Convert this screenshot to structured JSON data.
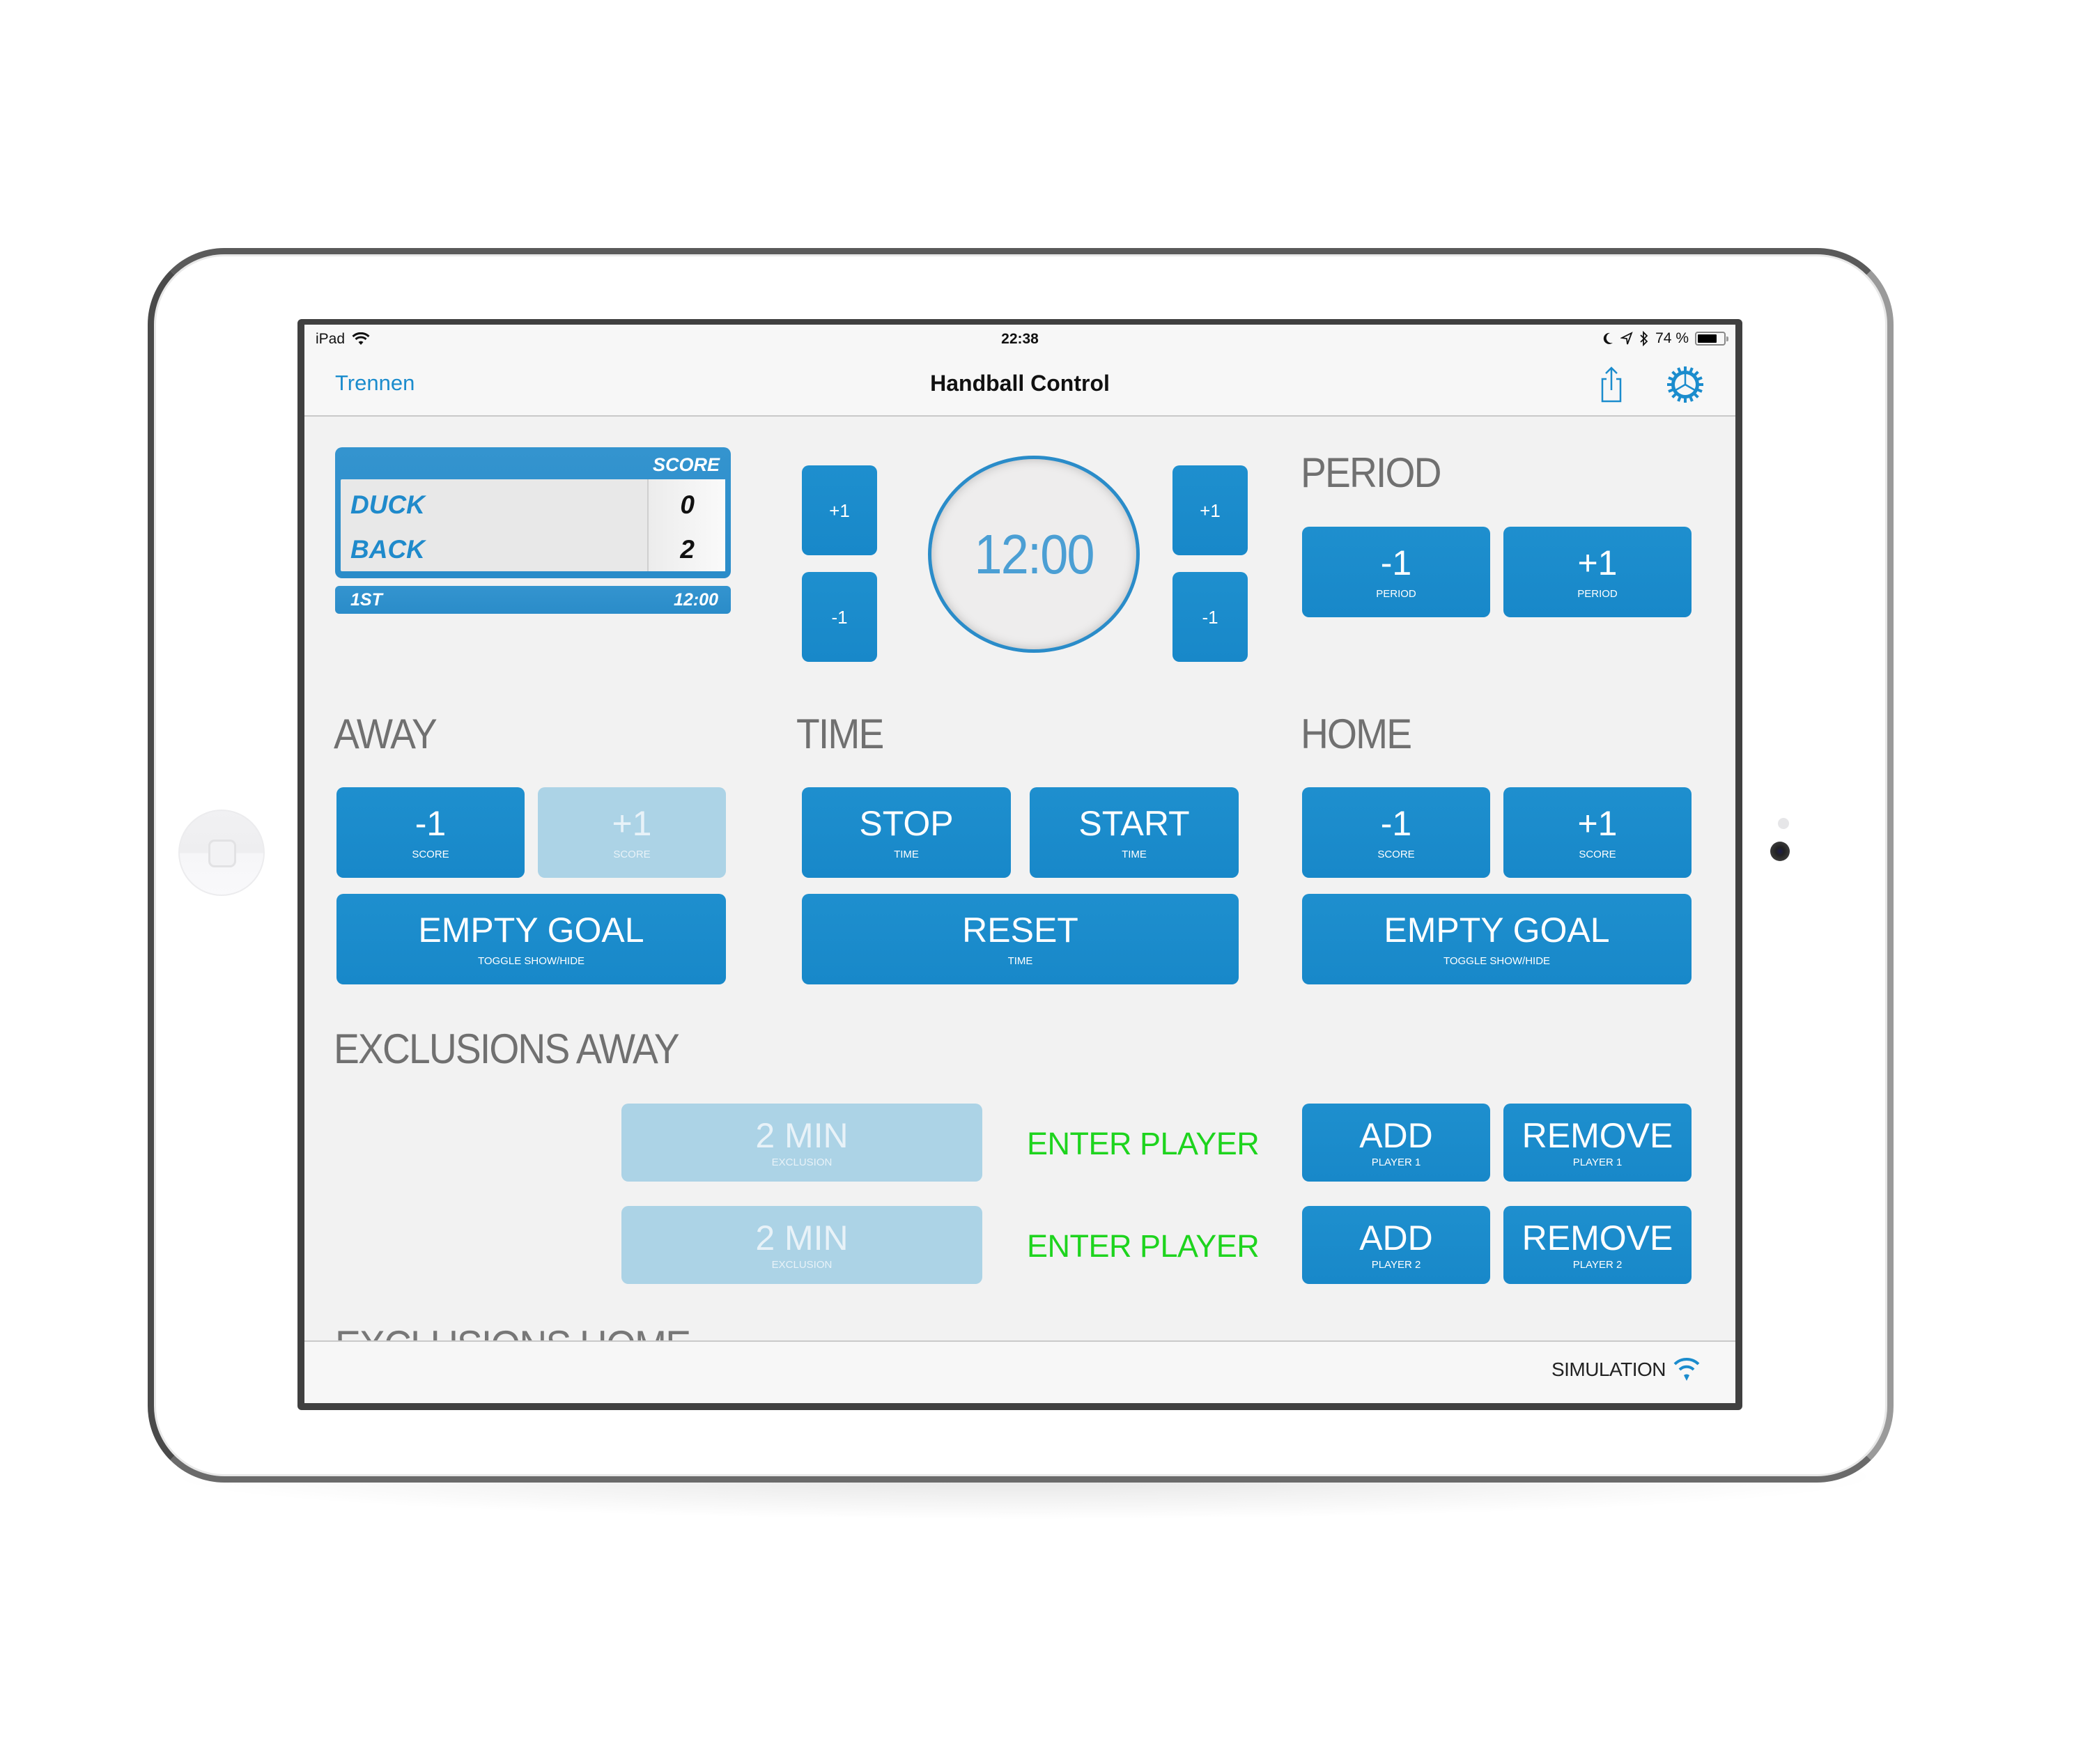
{
  "status_bar": {
    "device": "iPad",
    "time": "22:38",
    "battery_text": "74 %",
    "battery_level": 0.74,
    "icons": [
      "wifi-icon",
      "moon-icon",
      "location-arrow-icon",
      "bluetooth-icon",
      "battery-icon"
    ]
  },
  "nav": {
    "back_label": "Trennen",
    "title": "Handball Control",
    "icons": [
      "share-icon",
      "gear-icon"
    ]
  },
  "scoreboard": {
    "score_header": "SCORE",
    "teams": [
      {
        "name": "DUCK",
        "score": "0"
      },
      {
        "name": "BACK",
        "score": "2"
      }
    ],
    "period": "1ST",
    "time": "12:00"
  },
  "clock": {
    "display": "12:00",
    "left_buttons": {
      "plus": "+1",
      "minus": "-1"
    },
    "right_buttons": {
      "plus": "+1",
      "minus": "-1"
    }
  },
  "period": {
    "heading": "PERIOD",
    "minus": {
      "main": "-1",
      "sub": "PERIOD"
    },
    "plus": {
      "main": "+1",
      "sub": "PERIOD"
    }
  },
  "away": {
    "heading": "AWAY",
    "minus": {
      "main": "-1",
      "sub": "SCORE",
      "enabled": true
    },
    "plus": {
      "main": "+1",
      "sub": "SCORE",
      "enabled": false
    },
    "empty_goal": {
      "main": "EMPTY GOAL",
      "sub": "TOGGLE SHOW/HIDE"
    }
  },
  "time": {
    "heading": "TIME",
    "stop": {
      "main": "STOP",
      "sub": "TIME"
    },
    "start": {
      "main": "START",
      "sub": "TIME"
    },
    "reset": {
      "main": "RESET",
      "sub": "TIME"
    }
  },
  "home": {
    "heading": "HOME",
    "minus": {
      "main": "-1",
      "sub": "SCORE"
    },
    "plus": {
      "main": "+1",
      "sub": "SCORE"
    },
    "empty_goal": {
      "main": "EMPTY GOAL",
      "sub": "TOGGLE SHOW/HIDE"
    }
  },
  "exclusions_away": {
    "heading": "EXCLUSIONS AWAY",
    "rows": [
      {
        "exclusion": {
          "main": "2 MIN",
          "sub": "EXCLUSION",
          "enabled": false
        },
        "player_label": "ENTER PLAYER",
        "add": {
          "main": "ADD",
          "sub": "PLAYER 1"
        },
        "remove": {
          "main": "REMOVE",
          "sub": "PLAYER 1"
        }
      },
      {
        "exclusion": {
          "main": "2 MIN",
          "sub": "EXCLUSION",
          "enabled": false
        },
        "player_label": "ENTER PLAYER",
        "add": {
          "main": "ADD",
          "sub": "PLAYER 2"
        },
        "remove": {
          "main": "REMOVE",
          "sub": "PLAYER 2"
        }
      }
    ]
  },
  "exclusions_home": {
    "heading": "EXCLUSIONS HOME"
  },
  "toolbar": {
    "connection_label": "SIMULATION",
    "connection_icon": "wifi-icon"
  },
  "colors": {
    "accent": "#1b8ccd",
    "button": "#1e8fce",
    "button_disabled": "#acd3e6",
    "enter_player": "#1ed41e",
    "heading": "#707070",
    "background": "#f2f2f2"
  }
}
